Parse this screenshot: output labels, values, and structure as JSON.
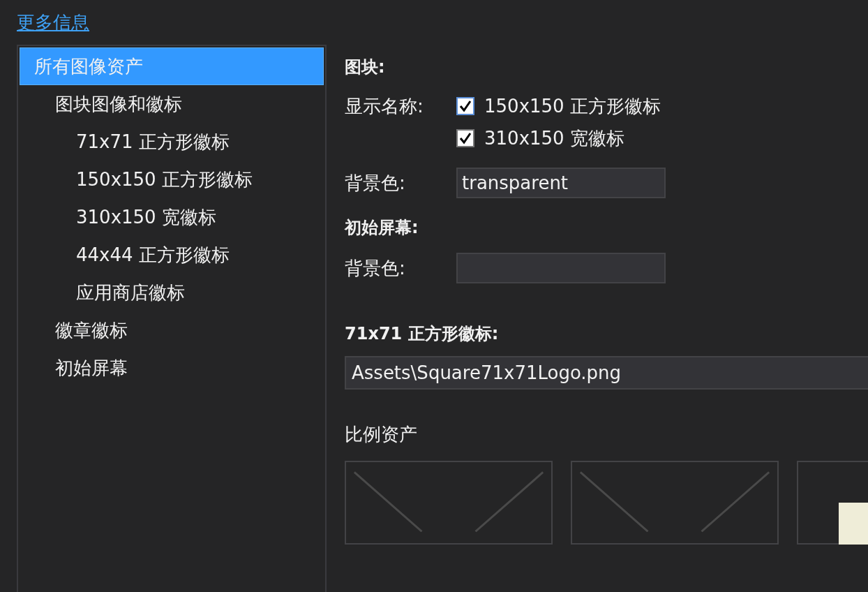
{
  "more_info_link": "更多信息",
  "tree": [
    {
      "label": "所有图像资产",
      "selected": true,
      "children": [
        {
          "label": "图块图像和徽标",
          "selected": false,
          "children": [
            {
              "label": "71x71 正方形徽标",
              "selected": false
            },
            {
              "label": "150x150 正方形徽标",
              "selected": false
            },
            {
              "label": "310x150 宽徽标",
              "selected": false
            },
            {
              "label": "44x44 正方形徽标",
              "selected": false
            },
            {
              "label": "应用商店徽标",
              "selected": false
            }
          ]
        },
        {
          "label": "徽章徽标",
          "selected": false
        },
        {
          "label": "初始屏幕",
          "selected": false
        }
      ]
    }
  ],
  "tile": {
    "heading": "图块:",
    "show_name_label": "显示名称:",
    "show_name_options": [
      {
        "label": "150x150 正方形徽标",
        "checked": true
      },
      {
        "label": "310x150 宽徽标",
        "checked": true
      }
    ],
    "background_label": "背景色:",
    "background_value": "transparent"
  },
  "splash": {
    "heading": "初始屏幕:",
    "background_label": "背景色:"
  },
  "logo_71": {
    "heading": "71x71 正方形徽标:",
    "path": "Assets\\Square71x71Logo.png"
  },
  "scale_assets": {
    "label": "比例资产",
    "images": [
      {
        "kind": "empty"
      },
      {
        "kind": "empty"
      },
      {
        "kind": "image"
      }
    ]
  }
}
